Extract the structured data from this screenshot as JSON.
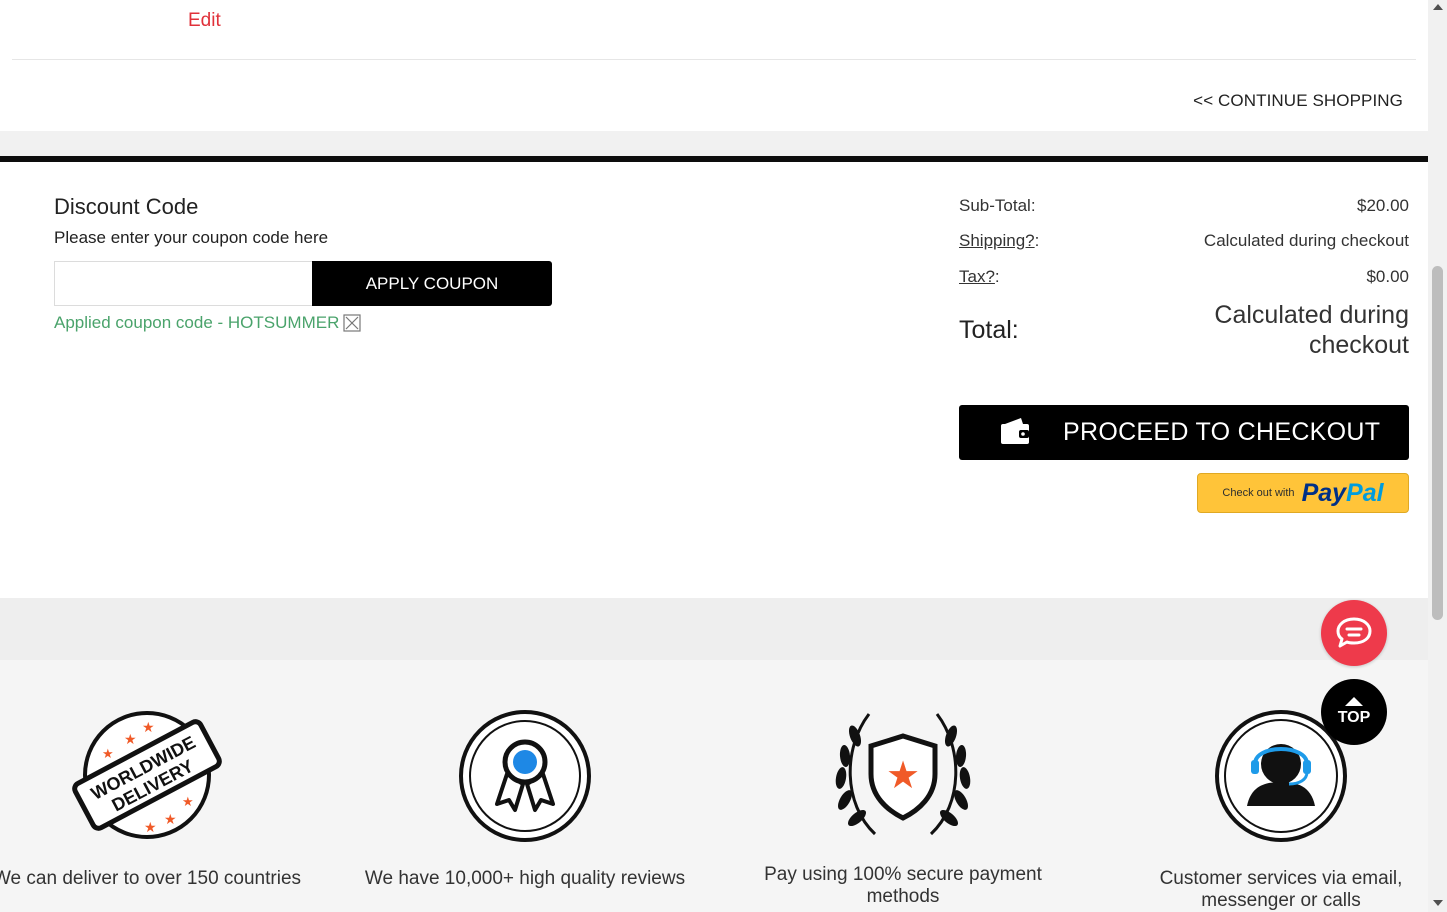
{
  "top": {
    "edit_label": "Edit",
    "continue_label": "<< CONTINUE SHOPPING"
  },
  "discount": {
    "title": "Discount Code",
    "subtitle": "Please enter your coupon code here",
    "input_value": "",
    "apply_label": "APPLY COUPON",
    "applied_note": "Applied coupon code - HOTSUMMER",
    "note_color": "#4aa36b"
  },
  "totals": {
    "subtotal_label": "Sub-Total:",
    "subtotal_value": "$20.00",
    "shipping_link": "Shipping?",
    "shipping_colon": ":",
    "shipping_value": "Calculated during checkout",
    "tax_link": "Tax?",
    "tax_colon": ":",
    "tax_value": "$0.00",
    "total_label": "Total:",
    "total_value": "Calculated during checkout"
  },
  "checkout": {
    "proceed_label": "PROCEED TO CHECKOUT",
    "icon": "wallet-icon"
  },
  "paypal": {
    "prefix": "Check out with",
    "pay": "Pay",
    "pal": "Pal"
  },
  "features": [
    {
      "text": "We can deliver to over 150 countries",
      "icon": "worldwide-delivery-badge-icon",
      "badge_line1": "WORLDWIDE",
      "badge_line2": "DELIVERY"
    },
    {
      "text": "We have 10,000+ high quality reviews",
      "icon": "award-ribbon-icon"
    },
    {
      "text": "Pay using 100% secure payment methods",
      "icon": "shield-star-laurel-icon"
    },
    {
      "text": "Customer services via email, messenger or calls",
      "icon": "customer-service-headset-icon"
    }
  ],
  "floating": {
    "chat_icon": "chat-icon",
    "top_label": "TOP"
  },
  "colors": {
    "accent_red": "#e0313a",
    "chat_red": "#ee3a4b",
    "badge_orange": "#f05a28",
    "ribbon_blue": "#1e88e5",
    "headset_blue": "#1e9be9",
    "paypal_yellow": "#ffc439"
  }
}
